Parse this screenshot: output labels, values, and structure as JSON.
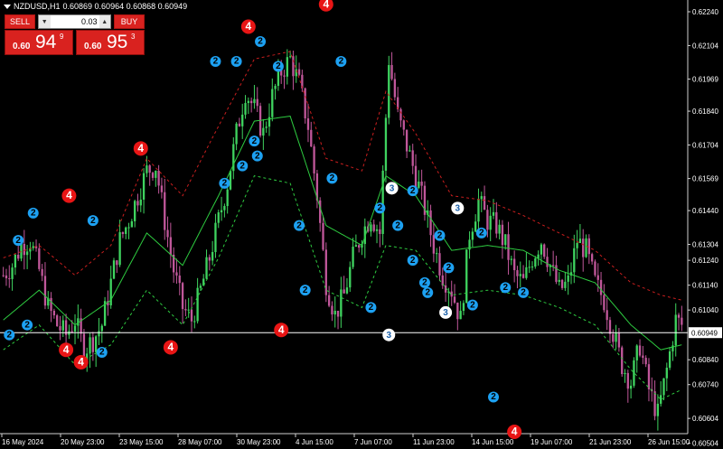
{
  "title": {
    "symbol": "NZDUSD,H1",
    "quote": "0.60869 0.60964 0.60868 0.60949"
  },
  "trade_panel": {
    "sell_label": "SELL",
    "buy_label": "BUY",
    "lot_value": "0.03",
    "sell_small": "0.60",
    "sell_big": "94",
    "sell_sup": "9",
    "buy_small": "0.60",
    "buy_big": "95",
    "buy_sup": "3"
  },
  "colors": {
    "background": "#000000",
    "bull": "#3fd35f",
    "bear": "#c0579a",
    "ma": "#2ecc40",
    "upper_band": "#c81e1e",
    "lower_band": "#2ecc40",
    "current_price_line": "#ffffff",
    "marker_2": "#1da1f2",
    "marker_3": "#ffffff",
    "marker_4": "#e81515"
  },
  "chart_data": {
    "type": "candlestick",
    "symbol": "NZDUSD",
    "timeframe": "H1",
    "ylim": [
      0.6055,
      0.6228
    ],
    "current_price": 0.60949,
    "current_price_label": "0.60949",
    "y_ticks": [
      "0.62240",
      "0.62104",
      "0.61969",
      "0.61840",
      "0.61704",
      "0.61569",
      "0.61440",
      "0.61304",
      "0.61240",
      "0.61140",
      "0.61040",
      "0.60949",
      "0.60840",
      "0.60740",
      "0.60604",
      "0.60504"
    ],
    "x_ticks": [
      "16 May 2024",
      "20 May 23:00",
      "23 May 15:00",
      "28 May 07:00",
      "30 May 23:00",
      "4 Jun 15:00",
      "7 Jun 07:00",
      "11 Jun 23:00",
      "14 Jun 15:00",
      "19 Jun 07:00",
      "21 Jun 23:00",
      "26 Jun 15:00"
    ],
    "trend_path": [
      [
        0,
        0.6118
      ],
      [
        3,
        0.6122
      ],
      [
        6,
        0.613
      ],
      [
        9,
        0.6132
      ],
      [
        12,
        0.612
      ],
      [
        15,
        0.6105
      ],
      [
        18,
        0.6098
      ],
      [
        21,
        0.6094
      ],
      [
        24,
        0.61
      ],
      [
        27,
        0.6088
      ],
      [
        30,
        0.6092
      ],
      [
        33,
        0.6098
      ],
      [
        36,
        0.6115
      ],
      [
        39,
        0.6132
      ],
      [
        42,
        0.614
      ],
      [
        45,
        0.615
      ],
      [
        48,
        0.616
      ],
      [
        51,
        0.6162
      ],
      [
        54,
        0.614
      ],
      [
        57,
        0.612
      ],
      [
        60,
        0.6105
      ],
      [
        63,
        0.61
      ],
      [
        66,
        0.6112
      ],
      [
        69,
        0.6125
      ],
      [
        72,
        0.614
      ],
      [
        75,
        0.6155
      ],
      [
        78,
        0.6175
      ],
      [
        81,
        0.6192
      ],
      [
        84,
        0.6185
      ],
      [
        87,
        0.6175
      ],
      [
        90,
        0.619
      ],
      [
        93,
        0.62
      ],
      [
        96,
        0.6205
      ],
      [
        99,
        0.6195
      ],
      [
        102,
        0.6178
      ],
      [
        105,
        0.615
      ],
      [
        108,
        0.6115
      ],
      [
        111,
        0.6102
      ],
      [
        114,
        0.611
      ],
      [
        117,
        0.6125
      ],
      [
        120,
        0.6135
      ],
      [
        123,
        0.6142
      ],
      [
        126,
        0.6135
      ],
      [
        129,
        0.6205
      ],
      [
        132,
        0.6182
      ],
      [
        135,
        0.617
      ],
      [
        138,
        0.6158
      ],
      [
        141,
        0.6145
      ],
      [
        144,
        0.613
      ],
      [
        147,
        0.6118
      ],
      [
        150,
        0.6112
      ],
      [
        153,
        0.61
      ],
      [
        156,
        0.6135
      ],
      [
        159,
        0.6148
      ],
      [
        162,
        0.614
      ],
      [
        165,
        0.6138
      ],
      [
        168,
        0.613
      ],
      [
        171,
        0.6118
      ],
      [
        174,
        0.6115
      ],
      [
        177,
        0.6125
      ],
      [
        180,
        0.6132
      ],
      [
        183,
        0.6122
      ],
      [
        186,
        0.6112
      ],
      [
        189,
        0.6115
      ],
      [
        192,
        0.6132
      ],
      [
        195,
        0.6128
      ],
      [
        198,
        0.6115
      ],
      [
        201,
        0.6108
      ],
      [
        204,
        0.6095
      ],
      [
        207,
        0.6082
      ],
      [
        210,
        0.6075
      ],
      [
        213,
        0.609
      ],
      [
        216,
        0.6072
      ],
      [
        219,
        0.6062
      ],
      [
        222,
        0.608
      ],
      [
        225,
        0.61
      ],
      [
        227,
        0.6098
      ]
    ],
    "ma_path": [
      [
        0,
        0.61
      ],
      [
        12,
        0.6112
      ],
      [
        24,
        0.6098
      ],
      [
        36,
        0.6108
      ],
      [
        48,
        0.6135
      ],
      [
        60,
        0.6122
      ],
      [
        72,
        0.615
      ],
      [
        84,
        0.618
      ],
      [
        96,
        0.6182
      ],
      [
        108,
        0.6138
      ],
      [
        120,
        0.613
      ],
      [
        128,
        0.6158
      ],
      [
        138,
        0.615
      ],
      [
        150,
        0.6128
      ],
      [
        162,
        0.613
      ],
      [
        174,
        0.6128
      ],
      [
        186,
        0.612
      ],
      [
        198,
        0.6115
      ],
      [
        210,
        0.6098
      ],
      [
        220,
        0.6088
      ],
      [
        227,
        0.609
      ]
    ],
    "upper_band_path": [
      [
        0,
        0.6125
      ],
      [
        12,
        0.613
      ],
      [
        24,
        0.6118
      ],
      [
        36,
        0.613
      ],
      [
        48,
        0.6165
      ],
      [
        60,
        0.615
      ],
      [
        72,
        0.6178
      ],
      [
        84,
        0.6205
      ],
      [
        96,
        0.6208
      ],
      [
        108,
        0.6165
      ],
      [
        120,
        0.616
      ],
      [
        128,
        0.6192
      ],
      [
        138,
        0.6175
      ],
      [
        150,
        0.615
      ],
      [
        162,
        0.6148
      ],
      [
        174,
        0.6142
      ],
      [
        186,
        0.6135
      ],
      [
        198,
        0.6128
      ],
      [
        210,
        0.6115
      ],
      [
        220,
        0.611
      ],
      [
        227,
        0.6108
      ]
    ],
    "lower_band_path": [
      [
        0,
        0.6088
      ],
      [
        12,
        0.6098
      ],
      [
        24,
        0.6082
      ],
      [
        36,
        0.609
      ],
      [
        48,
        0.6112
      ],
      [
        60,
        0.6098
      ],
      [
        72,
        0.6125
      ],
      [
        84,
        0.6158
      ],
      [
        96,
        0.6155
      ],
      [
        108,
        0.6112
      ],
      [
        120,
        0.6105
      ],
      [
        128,
        0.613
      ],
      [
        138,
        0.6128
      ],
      [
        150,
        0.611
      ],
      [
        162,
        0.6112
      ],
      [
        174,
        0.611
      ],
      [
        186,
        0.6105
      ],
      [
        198,
        0.6098
      ],
      [
        210,
        0.608
      ],
      [
        220,
        0.6068
      ],
      [
        227,
        0.6072
      ]
    ],
    "markers": [
      {
        "label": "2",
        "kind": "2",
        "x": 2,
        "price": 0.6094
      },
      {
        "label": "2",
        "kind": "2",
        "x": 5,
        "price": 0.6132
      },
      {
        "label": "2",
        "kind": "2",
        "x": 8,
        "price": 0.6098
      },
      {
        "label": "2",
        "kind": "2",
        "x": 10,
        "price": 0.6143
      },
      {
        "label": "4",
        "kind": "4",
        "x": 22,
        "price": 0.615
      },
      {
        "label": "4",
        "kind": "4",
        "x": 21,
        "price": 0.6088
      },
      {
        "label": "4",
        "kind": "4",
        "x": 26,
        "price": 0.6083
      },
      {
        "label": "2",
        "kind": "2",
        "x": 30,
        "price": 0.614
      },
      {
        "label": "2",
        "kind": "2",
        "x": 33,
        "price": 0.6087
      },
      {
        "label": "4",
        "kind": "4",
        "x": 46,
        "price": 0.6169
      },
      {
        "label": "4",
        "kind": "4",
        "x": 56,
        "price": 0.6089
      },
      {
        "label": "2",
        "kind": "2",
        "x": 71,
        "price": 0.6204
      },
      {
        "label": "2",
        "kind": "2",
        "x": 78,
        "price": 0.6204
      },
      {
        "label": "2",
        "kind": "2",
        "x": 74,
        "price": 0.6155
      },
      {
        "label": "2",
        "kind": "2",
        "x": 80,
        "price": 0.6162
      },
      {
        "label": "4",
        "kind": "4",
        "x": 82,
        "price": 0.6218
      },
      {
        "label": "2",
        "kind": "2",
        "x": 86,
        "price": 0.6212
      },
      {
        "label": "2",
        "kind": "2",
        "x": 85,
        "price": 0.6166
      },
      {
        "label": "2",
        "kind": "2",
        "x": 92,
        "price": 0.6202
      },
      {
        "label": "2",
        "kind": "2",
        "x": 84,
        "price": 0.6172
      },
      {
        "label": "4",
        "kind": "4",
        "x": 93,
        "price": 0.6096
      },
      {
        "label": "2",
        "kind": "2",
        "x": 101,
        "price": 0.6112
      },
      {
        "label": "2",
        "kind": "2",
        "x": 99,
        "price": 0.6138
      },
      {
        "label": "4",
        "kind": "4",
        "x": 108,
        "price": 0.6227
      },
      {
        "label": "2",
        "kind": "2",
        "x": 113,
        "price": 0.6204
      },
      {
        "label": "2",
        "kind": "2",
        "x": 110,
        "price": 0.6157
      },
      {
        "label": "3",
        "kind": "3",
        "x": 130,
        "price": 0.6153
      },
      {
        "label": "2",
        "kind": "2",
        "x": 126,
        "price": 0.6145
      },
      {
        "label": "2",
        "kind": "2",
        "x": 137,
        "price": 0.6152
      },
      {
        "label": "2",
        "kind": "2",
        "x": 123,
        "price": 0.6105
      },
      {
        "label": "2",
        "kind": "2",
        "x": 132,
        "price": 0.6138
      },
      {
        "label": "2",
        "kind": "2",
        "x": 137,
        "price": 0.6124
      },
      {
        "label": "3",
        "kind": "3",
        "x": 129,
        "price": 0.6094
      },
      {
        "label": "2",
        "kind": "2",
        "x": 146,
        "price": 0.6134
      },
      {
        "label": "2",
        "kind": "2",
        "x": 141,
        "price": 0.6115
      },
      {
        "label": "2",
        "kind": "2",
        "x": 142,
        "price": 0.6111
      },
      {
        "label": "3",
        "kind": "3",
        "x": 152,
        "price": 0.6145
      },
      {
        "label": "2",
        "kind": "2",
        "x": 149,
        "price": 0.6121
      },
      {
        "label": "3",
        "kind": "3",
        "x": 148,
        "price": 0.6103
      },
      {
        "label": "2",
        "kind": "2",
        "x": 160,
        "price": 0.6135
      },
      {
        "label": "2",
        "kind": "2",
        "x": 157,
        "price": 0.6106
      },
      {
        "label": "2",
        "kind": "2",
        "x": 168,
        "price": 0.6113
      },
      {
        "label": "2",
        "kind": "2",
        "x": 174,
        "price": 0.6111
      },
      {
        "label": "2",
        "kind": "2",
        "x": 164,
        "price": 0.6069
      },
      {
        "label": "4",
        "kind": "4",
        "x": 171,
        "price": 0.6055
      }
    ]
  }
}
